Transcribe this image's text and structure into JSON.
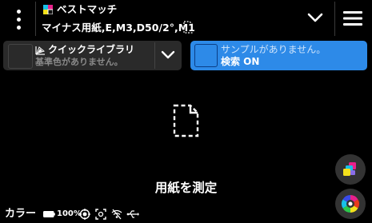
{
  "header": {
    "title": "ベストマッチ",
    "subtitle": "マイナス用紙,E,M3,D50/2°,M1",
    "icons": [
      "kebab-menu-icon",
      "color-mode-icon",
      "document-icon",
      "chevron-down-icon",
      "hamburger-menu-icon"
    ]
  },
  "panels": {
    "left": {
      "label": "クイックライブラリ",
      "sub": "基準色がありません。",
      "icon": "gamut-icon"
    },
    "right": {
      "label": "サンプルがありません。",
      "search": "検索 ON",
      "color": "#2d8ae8"
    }
  },
  "main": {
    "action": "用紙を測定"
  },
  "status": {
    "label": "カラー",
    "battery": "100%",
    "icons": [
      "battery-icon",
      "target-icon",
      "focus-icon",
      "wifi-off-icon",
      "usb-icon"
    ]
  },
  "colors": {
    "accent": "#2d8ae8",
    "background": "#000000",
    "panel": "#2a2a2a"
  }
}
